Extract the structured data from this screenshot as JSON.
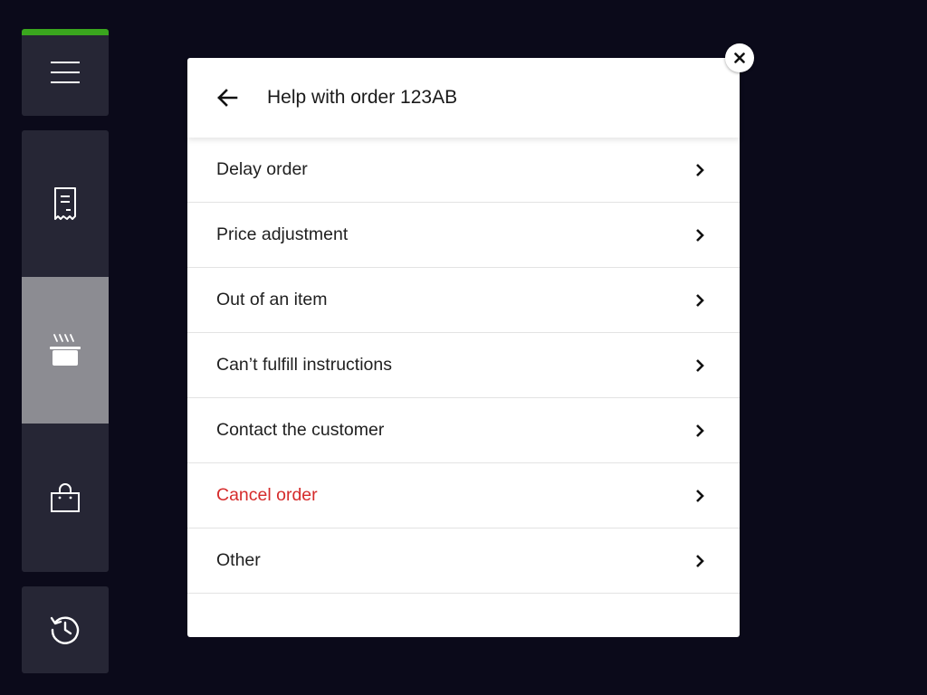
{
  "sidebar": {
    "accent_color": "#3aa61e",
    "items": [
      {
        "name": "menu",
        "icon": "hamburger-menu-icon"
      },
      {
        "name": "orders",
        "icon": "receipt-icon"
      },
      {
        "name": "kitchen",
        "icon": "cooking-pot-icon",
        "active": true
      },
      {
        "name": "pickup",
        "icon": "shopping-bag-icon"
      },
      {
        "name": "history",
        "icon": "history-clock-icon"
      }
    ]
  },
  "modal": {
    "title": "Help with order 123AB",
    "back_icon": "arrow-left-icon",
    "close_icon": "close-icon",
    "options": [
      {
        "label": "Delay order"
      },
      {
        "label": "Price adjustment"
      },
      {
        "label": "Out of an item"
      },
      {
        "label": "Can’t fulfill instructions"
      },
      {
        "label": "Contact the customer"
      },
      {
        "label": "Cancel order",
        "color": "#d52b2b"
      },
      {
        "label": "Other"
      }
    ]
  }
}
